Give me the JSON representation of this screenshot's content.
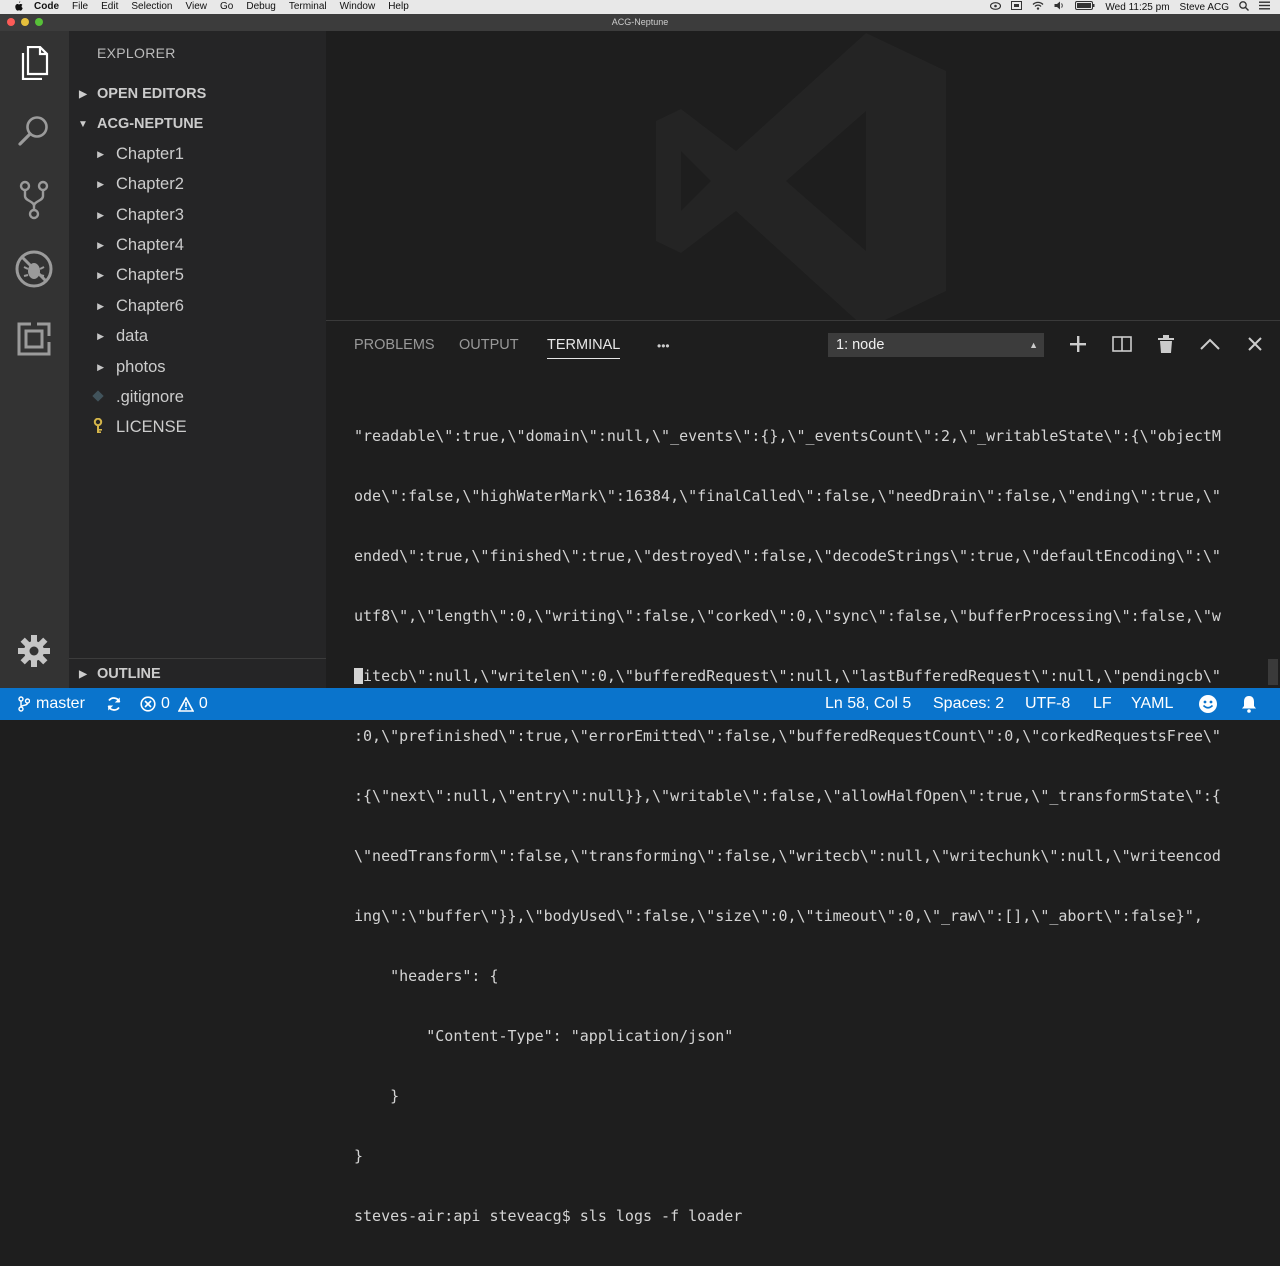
{
  "menubar": {
    "app": "Code",
    "items": [
      "File",
      "Edit",
      "Selection",
      "View",
      "Go",
      "Debug",
      "Terminal",
      "Window",
      "Help"
    ],
    "clock": "Wed 11:25 pm",
    "user": "Steve ACG"
  },
  "window": {
    "title": "ACG-Neptune"
  },
  "sidebar": {
    "title": "EXPLORER",
    "open_editors": "OPEN EDITORS",
    "project": "ACG-NEPTUNE",
    "items": [
      {
        "label": "Chapter1"
      },
      {
        "label": "Chapter2"
      },
      {
        "label": "Chapter3"
      },
      {
        "label": "Chapter4"
      },
      {
        "label": "Chapter5"
      },
      {
        "label": "Chapter6"
      },
      {
        "label": "data"
      },
      {
        "label": "photos"
      },
      {
        "label": ".gitignore"
      },
      {
        "label": "LICENSE"
      }
    ],
    "outline": "OUTLINE"
  },
  "panel": {
    "tabs": [
      "PROBLEMS",
      "OUTPUT",
      "TERMINAL"
    ],
    "more": "•••",
    "terminal_select": "1: node",
    "lines": [
      "\"readable\\\":true,\\\"domain\\\":null,\\\"_events\\\":{},\\\"_eventsCount\\\":2,\\\"_writableState\\\":{\\\"objectM",
      "ode\\\":false,\\\"highWaterMark\\\":16384,\\\"finalCalled\\\":false,\\\"needDrain\\\":false,\\\"ending\\\":true,\\\"",
      "ended\\\":true,\\\"finished\\\":true,\\\"destroyed\\\":false,\\\"decodeStrings\\\":true,\\\"defaultEncoding\\\":\\\"",
      "utf8\\\",\\\"length\\\":0,\\\"writing\\\":false,\\\"corked\\\":0,\\\"sync\\\":false,\\\"bufferProcessing\\\":false,\\\"w",
      "ritecb\\\":null,\\\"writelen\\\":0,\\\"bufferedRequest\\\":null,\\\"lastBufferedRequest\\\":null,\\\"pendingcb\\\"",
      ":0,\\\"prefinished\\\":true,\\\"errorEmitted\\\":false,\\\"bufferedRequestCount\\\":0,\\\"corkedRequestsFree\\\"",
      ":{\\\"next\\\":null,\\\"entry\\\":null}},\\\"writable\\\":false,\\\"allowHalfOpen\\\":true,\\\"_transformState\\\":{",
      "\\\"needTransform\\\":false,\\\"transforming\\\":false,\\\"writecb\\\":null,\\\"writechunk\\\":null,\\\"writeencod",
      "ing\\\":\\\"buffer\\\"}},\\\"bodyUsed\\\":false,\\\"size\\\":0,\\\"timeout\\\":0,\\\"_raw\\\":[],\\\"_abort\\\":false}\",",
      "    \"headers\": {",
      "        \"Content-Type\": \"application/json\"",
      "    }",
      "}",
      "steves-air:api steveacg$ sls logs -f loader"
    ]
  },
  "status": {
    "branch": "master",
    "errors": "0",
    "warnings": "0",
    "position": "Ln 58, Col 5",
    "spaces": "Spaces: 2",
    "encoding": "UTF-8",
    "eol": "LF",
    "language": "YAML"
  },
  "colors": {
    "statusbar": "#0a74cc",
    "activitybar": "#333333",
    "sidebar": "#252526",
    "editor": "#1e1e1e",
    "license_icon": "#d4b54a"
  }
}
